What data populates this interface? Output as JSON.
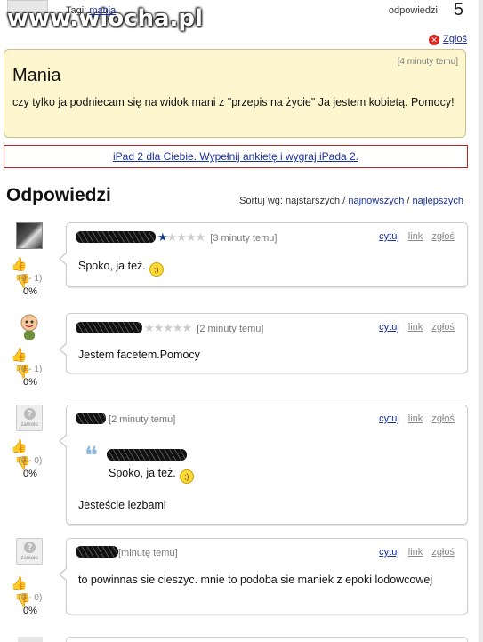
{
  "header": {
    "watermark": "www.wiocha.pl",
    "tags_label": "Tagi:",
    "tag": "mania",
    "answers_label": "odpowiedzi:",
    "answers_icon": "5"
  },
  "report": {
    "label": "Zgłoś",
    "icon": "report-icon"
  },
  "question": {
    "time": "[4 minuty temu]",
    "title": "Mania",
    "body": "czy tylko ja podniecam się na widok mani z \"przepis na życie\" Ja jestem kobietą. Pomocy!"
  },
  "ad": {
    "text": "iPad 2 dla Ciebie. Wypełnij ankietę i wygraj iPada 2."
  },
  "answers_section": {
    "title": "Odpowiedzi",
    "sort_label": "Sortuj wg: najstarszych /",
    "sort_newest": "najnowszych",
    "sort_sep": "/",
    "sort_best": "najlepszych"
  },
  "actions": {
    "quote": "cytuj",
    "link": "link",
    "report": "zgłoś"
  },
  "answers": [
    {
      "time": "[3 minuty temu]",
      "text": "Spoko, ja też.",
      "ratio": "(0 - 1)",
      "pct": "0%",
      "stars_on": 1
    },
    {
      "time": "[2 minuty temu]",
      "text": "Jestem facetem.Pomocy",
      "ratio": "(0 - 1)",
      "pct": "0%",
      "stars_on": 0
    },
    {
      "time": "[2 minuty temu]",
      "quote_text": "Spoko, ja też.",
      "text": "Jesteście lezbami",
      "ratio": "(0 - 0)",
      "pct": "0%",
      "avatar_label": "zamoiu"
    },
    {
      "time": "[minutę temu]",
      "text": "to powinnas sie cieszyc. mnie to podoba sie maniek z epoki lodowcowej",
      "ratio": "(0 - 0)",
      "pct": "0%",
      "avatar_label": "zamoiu"
    }
  ]
}
